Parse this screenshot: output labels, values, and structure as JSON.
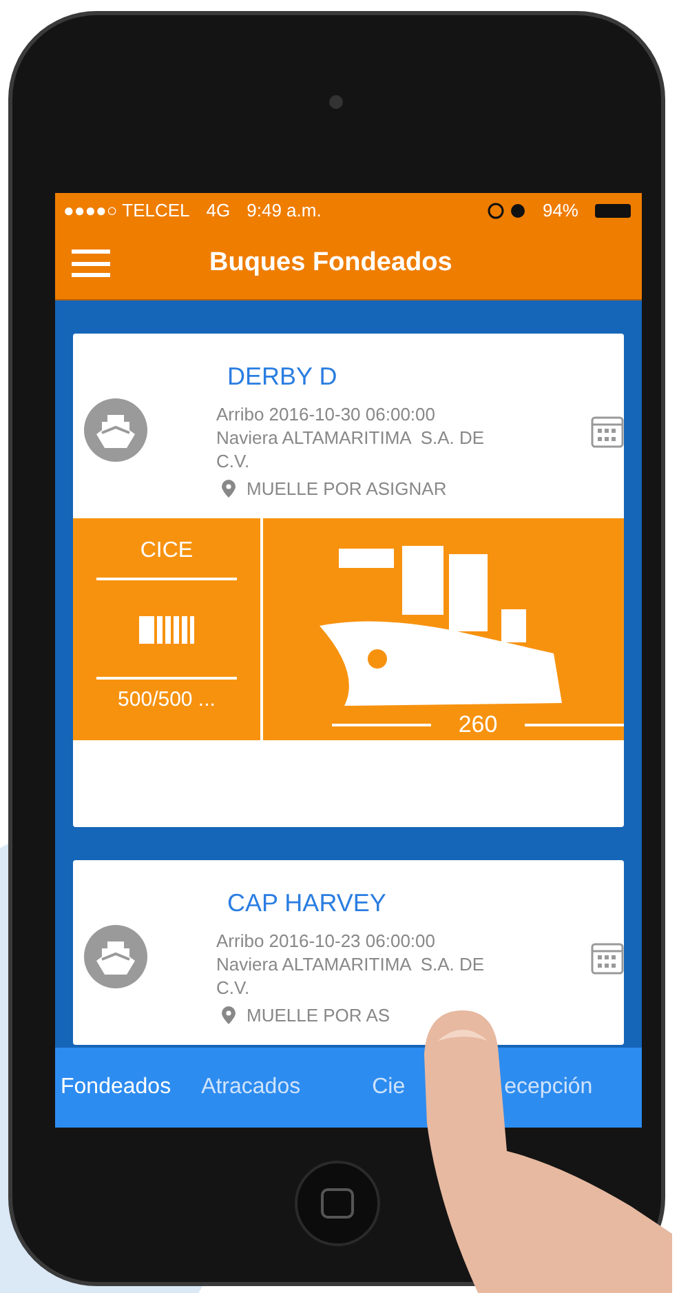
{
  "status_bar": {
    "carrier": "●●●●○ TELCEL",
    "network": "4G",
    "time": "9:49 a.m.",
    "battery": "94%"
  },
  "header": {
    "title": "Buques Fondeados"
  },
  "cards": [
    {
      "name": "DERBY D",
      "arrival": "Arribo 2016-10-30 06:00:00",
      "shipping_line": "Naviera ALTAMARITIMA  S.A. DE\nC.V.",
      "location": "MUELLE POR ASIGNAR",
      "panel": {
        "label": "CICE",
        "count": "500/500 ...",
        "length": "260"
      }
    },
    {
      "name": "CAP HARVEY",
      "arrival": "Arribo 2016-10-23 06:00:00",
      "shipping_line": "Naviera ALTAMARITIMA  S.A. DE\nC.V.",
      "location": "MUELLE POR AS"
    }
  ],
  "tabs": [
    {
      "label": "Fondeados",
      "selected": true
    },
    {
      "label": "Atracados",
      "selected": false
    },
    {
      "label": "Cie",
      "selected": false
    },
    {
      "label": "ecepción",
      "selected": false
    }
  ]
}
